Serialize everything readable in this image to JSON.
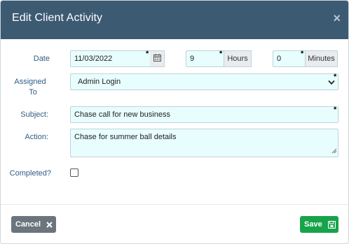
{
  "dialog": {
    "title": "Edit Client Activity",
    "close_symbol": "×"
  },
  "form": {
    "date_label": "Date",
    "date_value": "11/03/2022",
    "hours_value": "9",
    "hours_addon": "Hours",
    "minutes_value": "0",
    "minutes_addon": "Minutes",
    "assigned_label_line1": "Assigned",
    "assigned_label_line2": "To",
    "assigned_value": "Admin Login",
    "subject_label": "Subject:",
    "subject_value": "Chase call for new business",
    "action_label": "Action:",
    "action_value": "Chase for summer ball details",
    "completed_label": "Completed?",
    "completed_checked": false,
    "required_marker": "*"
  },
  "footer": {
    "cancel_label": "Cancel",
    "save_label": "Save"
  },
  "colors": {
    "header_bg": "#3d5a73",
    "field_bg": "#e8fdfd",
    "label_color": "#2d5d86",
    "cancel_bg": "#6c757d",
    "save_bg": "#17a34a"
  },
  "icons": {
    "close": "close-icon",
    "calendar": "calendar-icon",
    "dropdown": "chevron-down-icon",
    "cancel": "x-icon",
    "save": "floppy-disk-icon"
  }
}
